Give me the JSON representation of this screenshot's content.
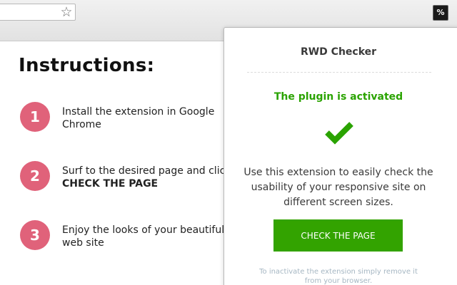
{
  "toolbar": {
    "star_icon": "star-icon",
    "extension_icon_label": "%"
  },
  "instructions": {
    "title": "Instructions:",
    "steps": [
      {
        "number": "1",
        "text": "Install the extension in Google Chrome"
      },
      {
        "number": "2",
        "text_before": "Surf to the desired page and click ",
        "text_bold": "CHECK THE PAGE"
      },
      {
        "number": "3",
        "text": "Enjoy the looks of your beautiful web site"
      }
    ]
  },
  "popup": {
    "title": "RWD Checker",
    "status": "The plugin is activated",
    "description": "Use this extension to easily check the usability of your responsive site on different screen sizes.",
    "button_label": "CHECK THE PAGE",
    "footnote": "To inactivate the extension simply remove it from your browser."
  },
  "colors": {
    "accent_green": "#33a300",
    "status_green": "#2aa300",
    "step_badge": "#e0627a"
  }
}
